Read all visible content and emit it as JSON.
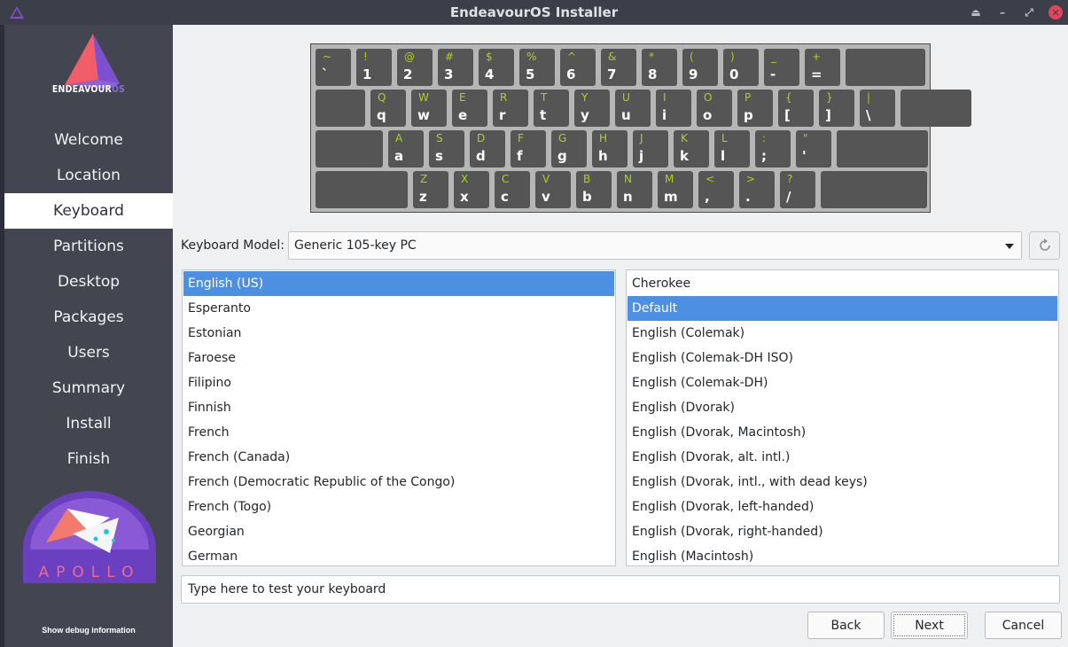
{
  "window": {
    "title": "EndeavourOS Installer"
  },
  "brand": {
    "logo_text": "ENDEAVOUR",
    "logo_text_accent": "OS",
    "badge_text": "APOLLO"
  },
  "sidebar": {
    "items": [
      {
        "label": "Welcome",
        "active": false
      },
      {
        "label": "Location",
        "active": false
      },
      {
        "label": "Keyboard",
        "active": true
      },
      {
        "label": "Partitions",
        "active": false
      },
      {
        "label": "Desktop",
        "active": false
      },
      {
        "label": "Packages",
        "active": false
      },
      {
        "label": "Users",
        "active": false
      },
      {
        "label": "Summary",
        "active": false
      },
      {
        "label": "Install",
        "active": false
      },
      {
        "label": "Finish",
        "active": false
      }
    ],
    "debug_label": "Show debug information"
  },
  "keyboard_preview": {
    "rows": [
      [
        [
          "~",
          "`"
        ],
        [
          "!",
          "1"
        ],
        [
          "@",
          "2"
        ],
        [
          "#",
          "3"
        ],
        [
          "$",
          "4"
        ],
        [
          "%",
          "5"
        ],
        [
          "^",
          "6"
        ],
        [
          "&",
          "7"
        ],
        [
          "*",
          "8"
        ],
        [
          "(",
          "9"
        ],
        [
          ")",
          "0"
        ],
        [
          "_",
          "-"
        ],
        [
          "+",
          "="
        ]
      ],
      [
        [
          "Q",
          "q"
        ],
        [
          "W",
          "w"
        ],
        [
          "E",
          "e"
        ],
        [
          "R",
          "r"
        ],
        [
          "T",
          "t"
        ],
        [
          "Y",
          "y"
        ],
        [
          "U",
          "u"
        ],
        [
          "I",
          "i"
        ],
        [
          "O",
          "o"
        ],
        [
          "P",
          "p"
        ],
        [
          "{",
          "["
        ],
        [
          "}",
          "]"
        ],
        [
          "|",
          "\\"
        ]
      ],
      [
        [
          "A",
          "a"
        ],
        [
          "S",
          "s"
        ],
        [
          "D",
          "d"
        ],
        [
          "F",
          "f"
        ],
        [
          "G",
          "g"
        ],
        [
          "H",
          "h"
        ],
        [
          "J",
          "j"
        ],
        [
          "K",
          "k"
        ],
        [
          "L",
          "l"
        ],
        [
          ":",
          ";"
        ],
        [
          "\"",
          "'"
        ]
      ],
      [
        [
          "Z",
          "z"
        ],
        [
          "X",
          "x"
        ],
        [
          "C",
          "c"
        ],
        [
          "V",
          "v"
        ],
        [
          "B",
          "b"
        ],
        [
          "N",
          "n"
        ],
        [
          "M",
          "m"
        ],
        [
          "<",
          ","
        ],
        [
          ">",
          "."
        ],
        [
          "?",
          "/"
        ]
      ]
    ]
  },
  "model": {
    "label": "Keyboard Model:",
    "value": "Generic 105-key PC"
  },
  "layouts": {
    "items": [
      "English (US)",
      "Esperanto",
      "Estonian",
      "Faroese",
      "Filipino",
      "Finnish",
      "French",
      "French (Canada)",
      "French (Democratic Republic of the Congo)",
      "French (Togo)",
      "Georgian",
      "German"
    ],
    "selected": "English (US)"
  },
  "variants": {
    "items": [
      "Cherokee",
      "Default",
      "English (Colemak)",
      "English (Colemak-DH ISO)",
      "English (Colemak-DH)",
      "English (Dvorak)",
      "English (Dvorak, Macintosh)",
      "English (Dvorak, alt. intl.)",
      "English (Dvorak, intl., with dead keys)",
      "English (Dvorak, left-handed)",
      "English (Dvorak, right-handed)",
      "English (Macintosh)"
    ],
    "selected": "Default"
  },
  "test_input": {
    "placeholder": "Type here to test your keyboard"
  },
  "buttons": {
    "back": "Back",
    "next": "Next",
    "cancel": "Cancel"
  },
  "colors": {
    "accent": "#4d8fe0",
    "sidebar_bg": "#434651",
    "key_bg": "#555555",
    "key_shift": "#a8d41b"
  }
}
